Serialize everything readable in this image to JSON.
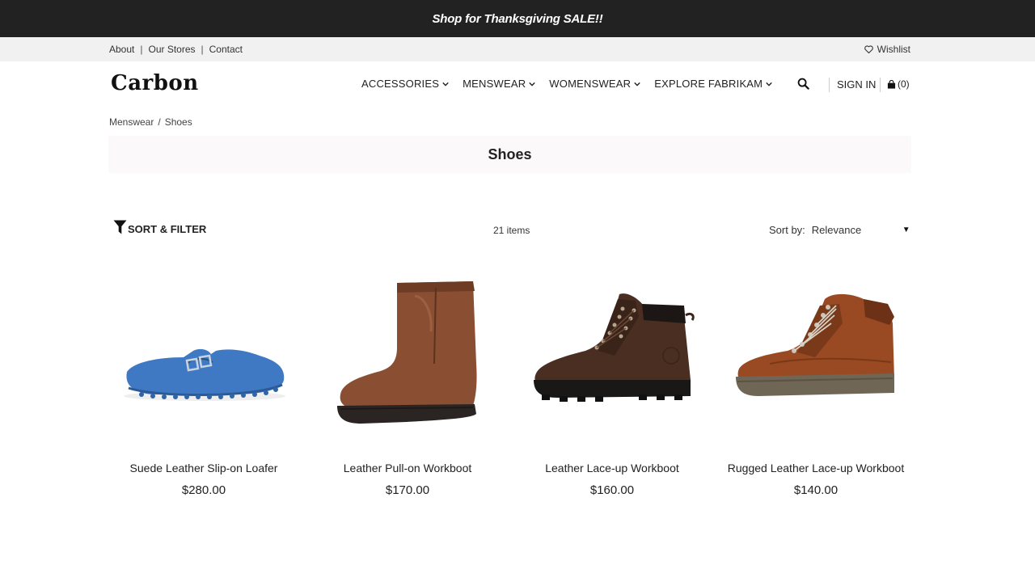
{
  "promo": {
    "text": "Shop for Thanksgiving SALE!!"
  },
  "utility": {
    "links": [
      "About",
      "Our Stores",
      "Contact"
    ],
    "wishlist": "Wishlist"
  },
  "header": {
    "logo": "Carbon",
    "nav": [
      "ACCESSORIES",
      "MENSWEAR",
      "WOMENSWEAR",
      "EXPLORE FABRIKAM"
    ],
    "sign_in": "SIGN IN",
    "cart_count": "(0)"
  },
  "breadcrumb": [
    "Menswear",
    "/",
    "Shoes"
  ],
  "page_title": "Shoes",
  "toolbar": {
    "filter_label": "SORT & FILTER",
    "item_count": "21 items",
    "sort_label": "Sort by:",
    "sort_value": "Relevance"
  },
  "products": [
    {
      "name": "Suede Leather Slip-on Loafer",
      "price": "$280.00",
      "color": "#3f79c4"
    },
    {
      "name": "Leather Pull-on Workboot",
      "price": "$170.00",
      "color": "#8a4f33"
    },
    {
      "name": "Leather Lace-up Workboot",
      "price": "$160.00",
      "color": "#4a2e22"
    },
    {
      "name": "Rugged Leather Lace-up Workboot",
      "price": "$140.00",
      "color": "#9a4a23"
    }
  ],
  "colors": {
    "promo_bg": "#222222",
    "utility_bg": "#f1f1f1",
    "title_band_bg": "#fbf9f9"
  },
  "icons": [
    "heart-icon",
    "chevron-down-icon",
    "search-icon",
    "shopping-bag-icon",
    "filter-icon",
    "caret-down-icon"
  ]
}
